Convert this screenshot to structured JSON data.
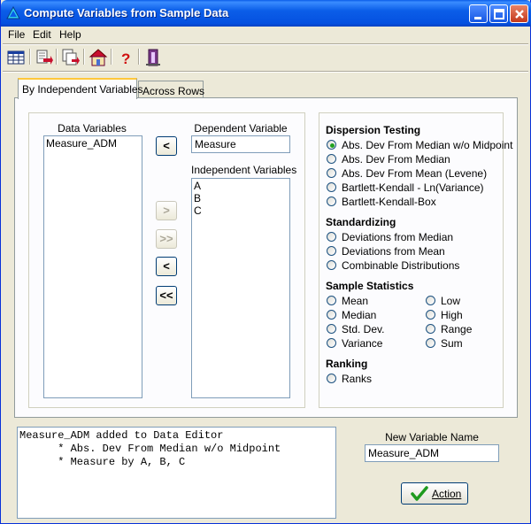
{
  "window": {
    "title": "Compute Variables from Sample Data"
  },
  "menubar": {
    "items": [
      "File",
      "Edit",
      "Help"
    ]
  },
  "toolbar": {
    "icons": [
      "spreadsheet-icon",
      "export-icon",
      "copy-export-icon",
      "home-icon",
      "help-icon",
      "exit-icon"
    ]
  },
  "tabs": [
    {
      "label": "By Independent Variables",
      "selected": true
    },
    {
      "label": "Across Rows",
      "selected": false
    }
  ],
  "data_variables": {
    "label": "Data Variables",
    "items": [
      "Measure_ADM"
    ]
  },
  "dependent_variable": {
    "label": "Dependent Variable",
    "value": "Measure"
  },
  "independent_variables": {
    "label": "Independent Variables",
    "items": [
      "A",
      "B",
      "C"
    ]
  },
  "transfer_buttons": {
    "move_left_dependent": "<",
    "move_right": ">",
    "move_all_right": ">>",
    "move_left": "<",
    "move_all_left": "<<"
  },
  "dispersion_testing": {
    "heading": "Dispersion Testing",
    "options": [
      "Abs. Dev From Median w/o Midpoint",
      "Abs. Dev From Median",
      "Abs. Dev From Mean (Levene)",
      "Bartlett-Kendall - Ln(Variance)",
      "Bartlett-Kendall-Box"
    ],
    "selected_index": 0
  },
  "standardizing": {
    "heading": "Standardizing",
    "options": [
      "Deviations from Median",
      "Deviations from Mean",
      "Combinable Distributions"
    ]
  },
  "sample_statistics": {
    "heading": "Sample Statistics",
    "left_options": [
      "Mean",
      "Median",
      "Std. Dev.",
      "Variance"
    ],
    "right_options": [
      "Low",
      "High",
      "Range",
      "Sum"
    ]
  },
  "ranking": {
    "heading": "Ranking",
    "options": [
      "Ranks"
    ]
  },
  "log": {
    "text": "Measure_ADM added to Data Editor\n      * Abs. Dev From Median w/o Midpoint\n      * Measure by A, B, C"
  },
  "new_variable": {
    "label": "New Variable Name",
    "value": "Measure_ADM"
  },
  "action_button": {
    "label": "Action"
  },
  "colors": {
    "title_blue": "#0a5de8",
    "face": "#ece9d8",
    "check_green": "#21a121"
  }
}
